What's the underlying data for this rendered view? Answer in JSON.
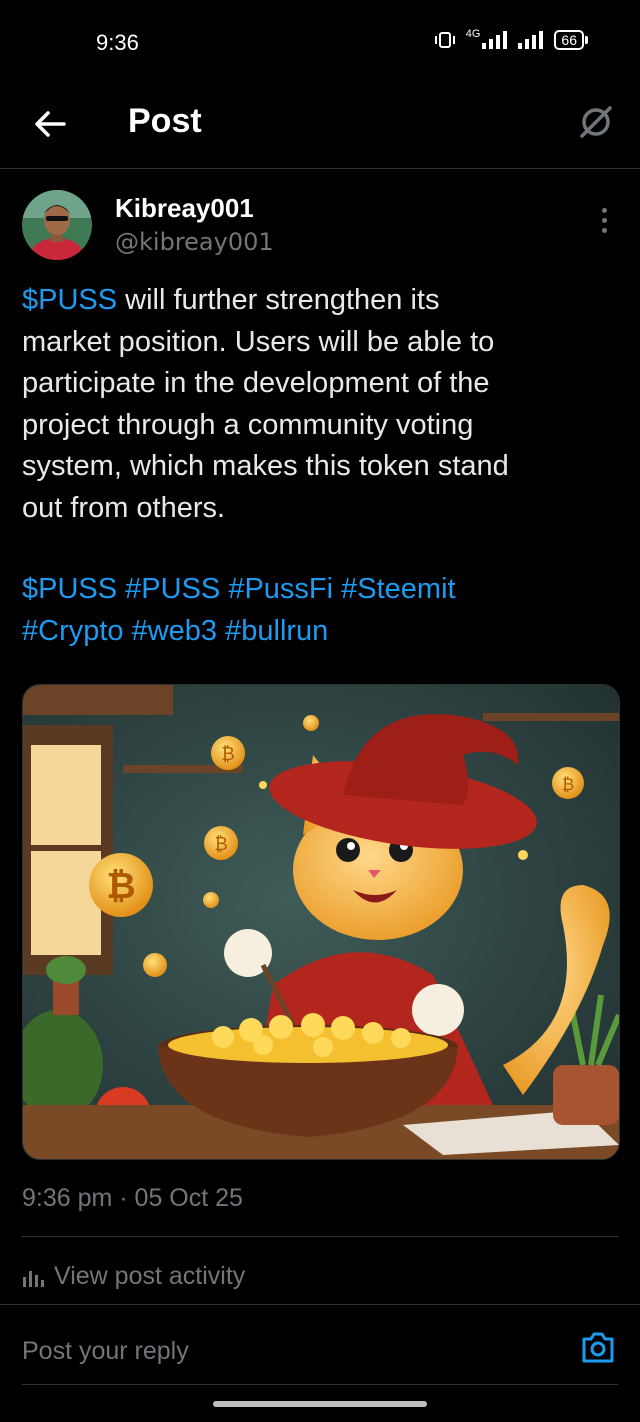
{
  "status_bar": {
    "time": "9:36",
    "network": "4G",
    "battery": "66"
  },
  "header": {
    "title": "Post"
  },
  "author": {
    "name": "Kibreay001",
    "handle": "@kibreay001"
  },
  "post": {
    "cashtag": "$PUSS",
    "line1_rest": " will further strengthen its",
    "lines": [
      "market position. Users will be able to",
      "participate in the development of the",
      "project through a community voting",
      "system, which makes this token stand",
      "out from others."
    ],
    "hashtag_line1": "$PUSS #PUSS #PussFi #Steemit",
    "hashtag_line2": "#Crypto #web3 #bullrun"
  },
  "meta": {
    "timestamp": "9:36 pm · 05 Oct 25",
    "view_activity": "View post activity"
  },
  "reply": {
    "placeholder": "Post your reply"
  },
  "colors": {
    "accent": "#1d9bf0",
    "muted": "#71767b",
    "background": "#000000",
    "divider": "#2f3336"
  },
  "icons": [
    "back-arrow-icon",
    "grok-icon",
    "more-options-icon",
    "analytics-icon",
    "camera-icon"
  ]
}
